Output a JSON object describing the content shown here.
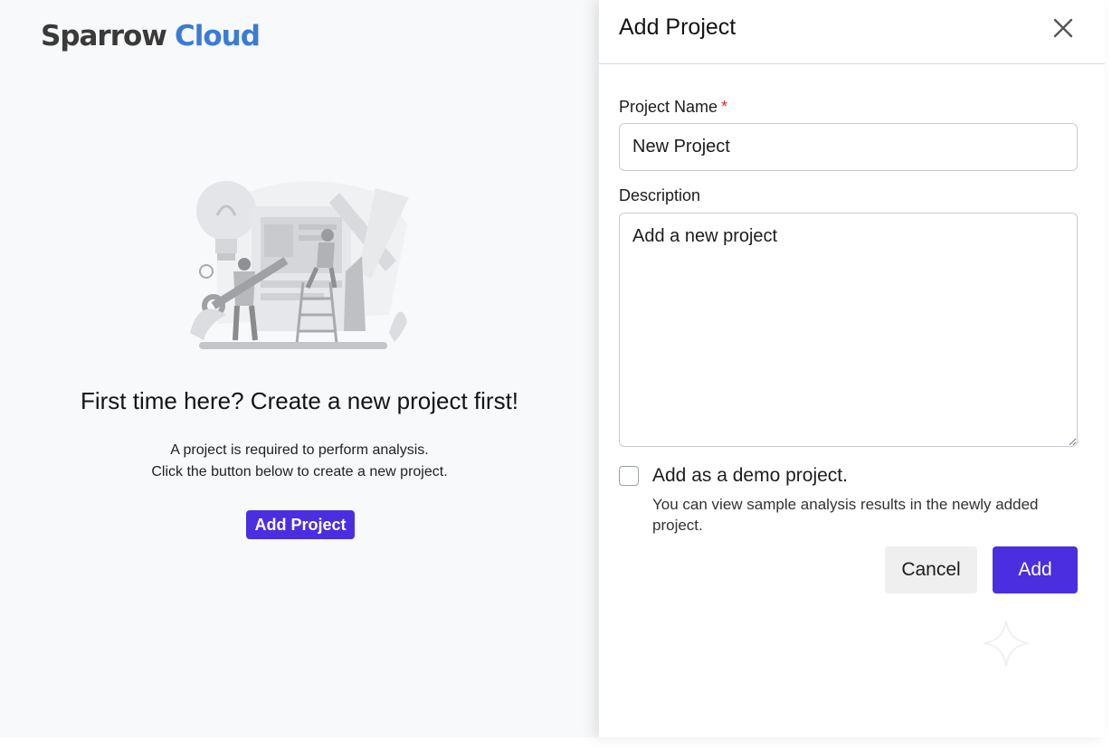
{
  "brand": {
    "word1": "Sparrow",
    "word2": "Cloud",
    "color_dark": "#3a3a3a",
    "color_accent": "#3a7bd5"
  },
  "empty_state": {
    "title": "First time here? Create a new project first!",
    "line1": "A project is required to perform analysis.",
    "line2": "Click the button below to create a new project.",
    "button_label": "Add Project",
    "illustration_icon": "project-setup-illustration"
  },
  "drawer": {
    "title": "Add Project",
    "close_icon": "close-icon",
    "name_label": "Project Name",
    "name_required_mark": "*",
    "name_value": "New Project",
    "description_label": "Description",
    "description_value": "Add a new project",
    "demo_checkbox_label": "Add as a demo project.",
    "demo_checkbox_checked": false,
    "demo_help_text": "You can view sample analysis results in the newly added project.",
    "cancel_label": "Cancel",
    "add_label": "Add"
  },
  "colors": {
    "primary": "#4a2ee0",
    "required": "#d32f2f",
    "page_bg": "#f8f9fb"
  }
}
